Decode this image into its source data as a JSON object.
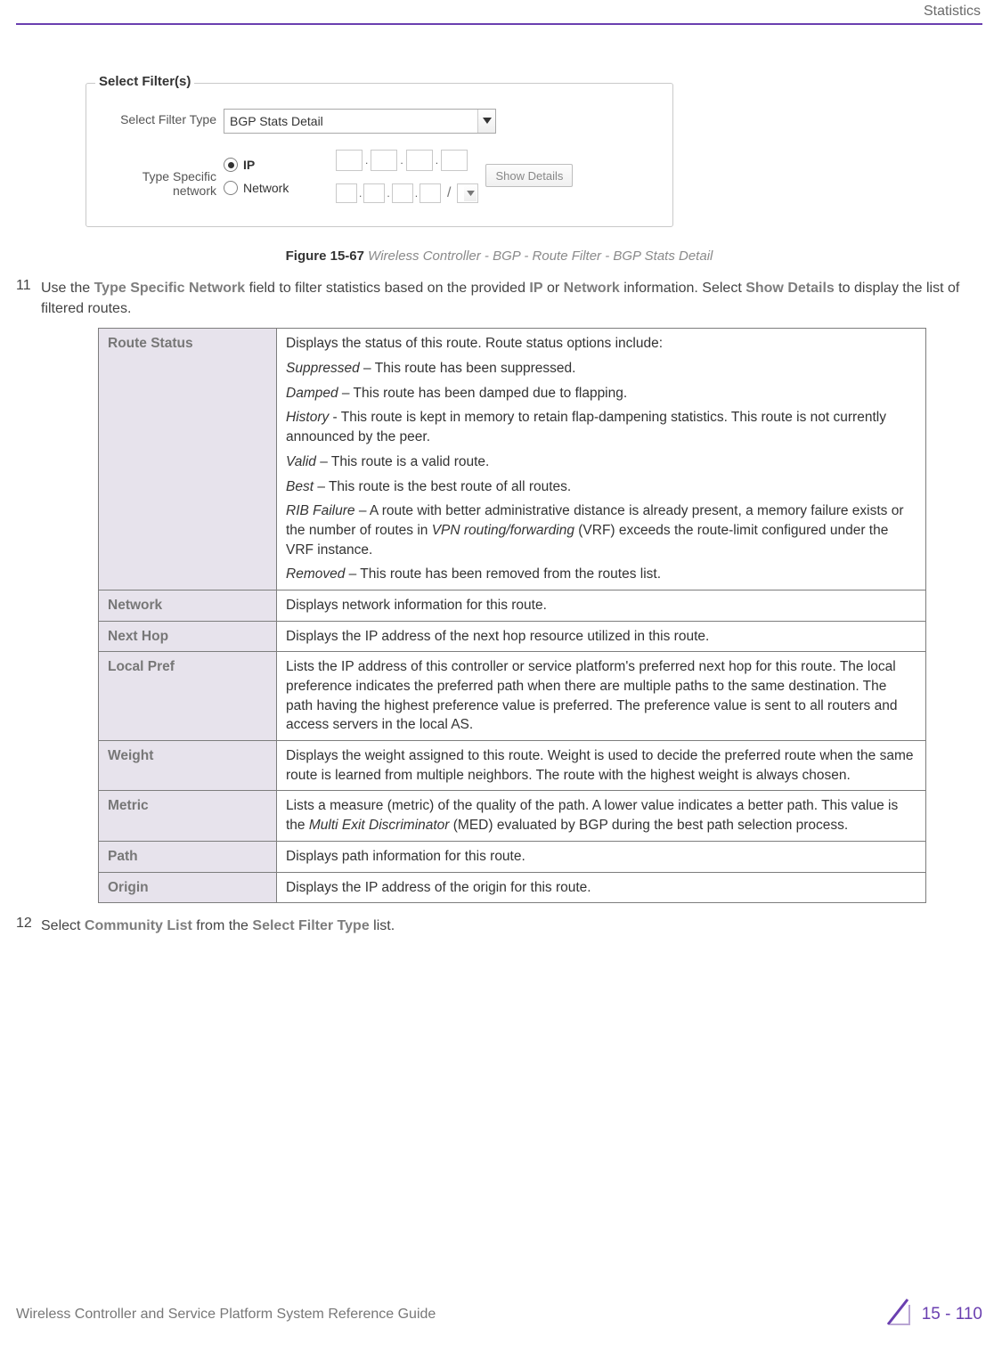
{
  "header": {
    "section_label": "Statistics"
  },
  "screenshot": {
    "legend": "Select Filter(s)",
    "filter_type_label": "Select Filter Type",
    "filter_type_value": "BGP Stats Detail",
    "type_specific_label": "Type Specific network",
    "radio_ip": "IP",
    "radio_network": "Network",
    "show_details_btn": "Show Details"
  },
  "figure": {
    "number": "Figure 15-67",
    "caption": "Wireless Controller - BGP - Route Filter - BGP Stats Detail"
  },
  "step11": {
    "num": "11",
    "text_pre": "Use the ",
    "b1": "Type Specific Network",
    "text_mid1": " field to filter statistics based on the provided ",
    "b2": "IP",
    "text_mid2": " or ",
    "b3": "Network",
    "text_mid3": " information. Select ",
    "b4": "Show Details",
    "text_end": " to display the list of filtered routes."
  },
  "table": [
    {
      "key": "Route Status",
      "lines": [
        {
          "plain": "Displays the status of this route. Route status options include:"
        },
        {
          "ital": "Suppressed",
          "rest": " – This route has been suppressed."
        },
        {
          "ital": "Damped",
          "rest": " – This route has been damped due to flapping."
        },
        {
          "ital": "History",
          "rest": " - This route is kept in memory to retain flap-dampening statistics. This route is not currently announced by the peer."
        },
        {
          "ital": "Valid",
          "rest": " – This route is a valid route."
        },
        {
          "ital": "Best",
          "rest": " – This route is the best route of all routes."
        },
        {
          "ital": "RIB Failure",
          "rest": " – A route with better administrative distance is already present, a memory failure exists or the number of routes in ",
          "ital2": "VPN routing/forwarding",
          "rest2": " (VRF) exceeds the route-limit configured under the VRF instance."
        },
        {
          "ital": "Removed",
          "rest": " – This route has been removed from the routes list."
        }
      ]
    },
    {
      "key": "Network",
      "lines": [
        {
          "plain": "Displays network information for this route."
        }
      ]
    },
    {
      "key": "Next Hop",
      "lines": [
        {
          "plain": "Displays the IP address of the next hop resource utilized in this route."
        }
      ]
    },
    {
      "key": "Local Pref",
      "lines": [
        {
          "plain": "Lists the IP address of this controller or service platform's preferred next hop for this route. The local preference indicates the preferred path when there are multiple paths to the same destination. The path having the highest preference value is preferred. The preference value is sent to all routers and access servers in the local AS."
        }
      ]
    },
    {
      "key": "Weight",
      "lines": [
        {
          "plain": "Displays the weight assigned to this route. Weight is used to decide the preferred route when the same route is learned from multiple neighbors. The route with the highest weight is always chosen."
        }
      ]
    },
    {
      "key": "Metric",
      "lines": [
        {
          "plain_pre": "Lists a measure (metric) of the quality of the path. A lower value indicates a better path. This value is the ",
          "ital": "Multi Exit Discriminator",
          "plain_post": " (MED) evaluated by BGP during the best path selection process."
        }
      ]
    },
    {
      "key": "Path",
      "lines": [
        {
          "plain": "Displays path information for this route."
        }
      ]
    },
    {
      "key": "Origin",
      "lines": [
        {
          "plain": "Displays the IP address of the origin for this route."
        }
      ]
    }
  ],
  "step12": {
    "num": "12",
    "text_pre": "Select ",
    "b1": "Community List",
    "text_mid": " from the ",
    "b2": "Select Filter Type",
    "text_end": " list."
  },
  "footer": {
    "guide": "Wireless Controller and Service Platform System Reference Guide",
    "page": "15 - 110"
  }
}
